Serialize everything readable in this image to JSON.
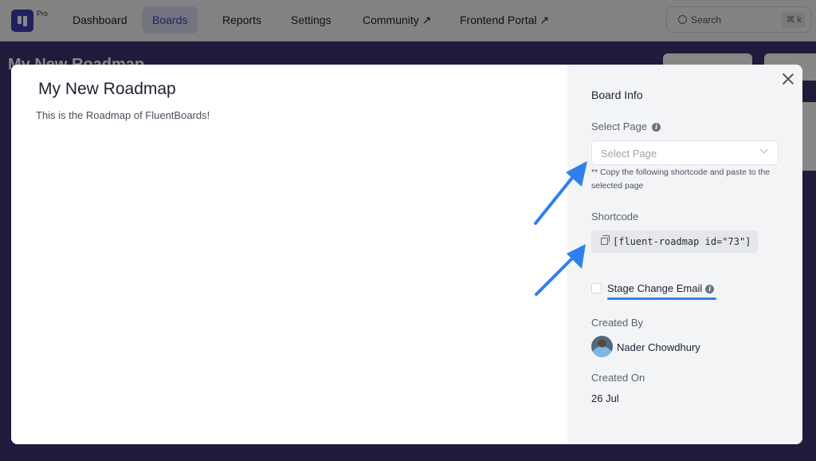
{
  "app": {
    "badge": "Pro",
    "logo_icon": "fluentboards-logo-icon"
  },
  "nav": {
    "items": [
      {
        "label": "Dashboard",
        "active": false
      },
      {
        "label": "Boards",
        "active": true
      },
      {
        "label": "Reports",
        "active": false
      },
      {
        "label": "Settings",
        "active": false
      },
      {
        "label": "Community ↗",
        "active": false
      },
      {
        "label": "Frontend Portal ↗",
        "active": false
      }
    ],
    "search": {
      "placeholder": "Search",
      "shortcut": "⌘ k"
    }
  },
  "board": {
    "title": "My New Roadmap"
  },
  "modal": {
    "title": "My New Roadmap",
    "description": "This is the Roadmap of FluentBoards!",
    "close_icon": "close-icon",
    "info": {
      "heading": "Board Info",
      "select_page_label": "Select Page",
      "select_page_placeholder": "Select Page",
      "note": "** Copy the following shortcode and paste to the selected page",
      "shortcode_label": "Shortcode",
      "shortcode_value": "[fluent-roadmap id=\"73\"]",
      "stage_change_email_label": "Stage Change Email",
      "stage_change_email_checked": false,
      "created_by_label": "Created By",
      "created_by_name": "Nader Chowdhury",
      "created_on_label": "Created On",
      "created_on_value": "26 Jul"
    }
  },
  "colors": {
    "brand": "#3a3fb0",
    "annotation_arrow": "#2f80ed",
    "board_background": "#3a356f"
  }
}
